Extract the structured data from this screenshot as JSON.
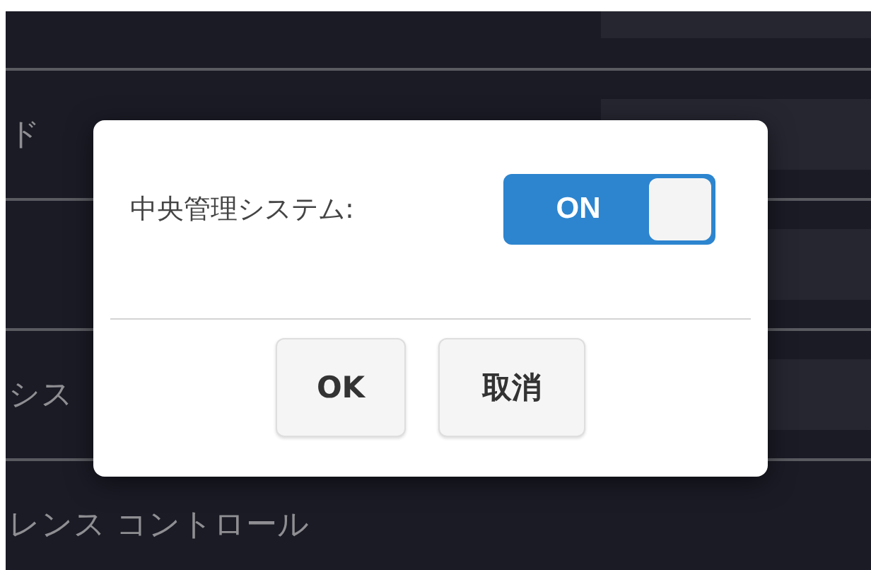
{
  "background_rows": [
    {
      "kind": "field"
    },
    {
      "label": "ド",
      "kind": "field"
    },
    {
      "kind": "field"
    },
    {
      "label": "シス",
      "kind": "field"
    },
    {
      "label": "レンス コントロール",
      "kind": "plain"
    }
  ],
  "dialog": {
    "setting_label": "中央管理システム:",
    "toggle": {
      "label": "ON",
      "on": true
    },
    "buttons": [
      "OK",
      "取消"
    ]
  }
}
